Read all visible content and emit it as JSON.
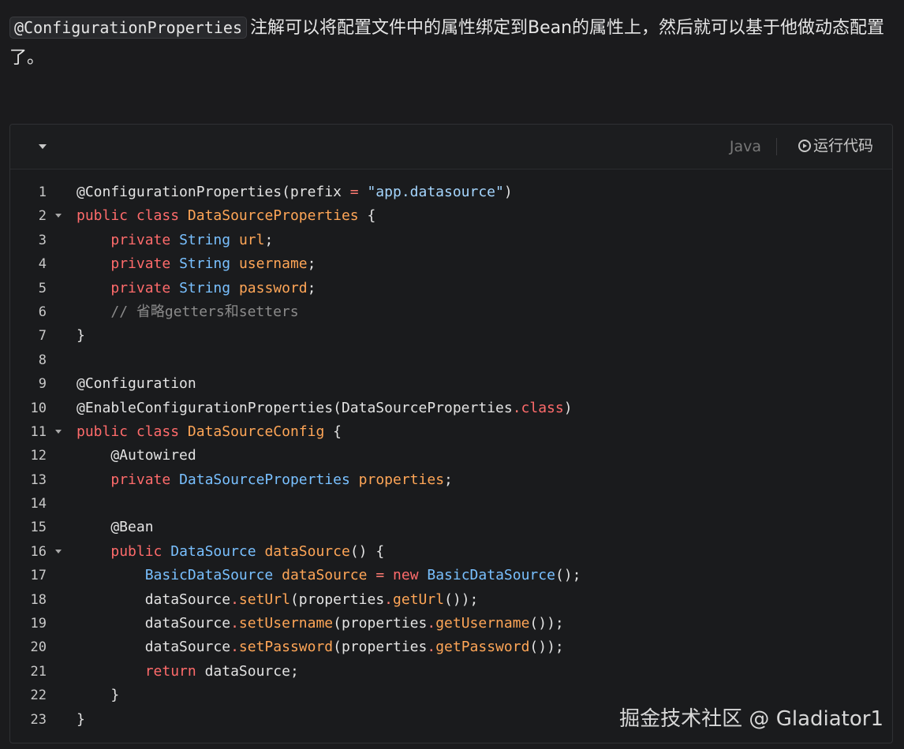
{
  "intro": {
    "code": "@ConfigurationProperties",
    "text": "注解可以将配置文件中的属性绑定到Bean的属性上，然后就可以基于他做动态配置了。"
  },
  "toolbar": {
    "language": "Java",
    "run_label": "运行代码",
    "collapse_icon": "chevron-down-icon",
    "run_icon": "play-circle-icon"
  },
  "code": {
    "lines": [
      {
        "n": "1",
        "fold": false,
        "tokens": [
          [
            "",
            "@ConfigurationProperties(prefix "
          ],
          [
            "op",
            "="
          ],
          [
            "",
            " "
          ],
          [
            "st",
            "\"app.datasource\""
          ],
          [
            "",
            ")"
          ]
        ]
      },
      {
        "n": "2",
        "fold": true,
        "tokens": [
          [
            "kw",
            "public"
          ],
          [
            "",
            " "
          ],
          [
            "kw",
            "class"
          ],
          [
            "",
            " "
          ],
          [
            "fn",
            "DataSourceProperties"
          ],
          [
            "",
            " {"
          ]
        ]
      },
      {
        "n": "3",
        "fold": false,
        "tokens": [
          [
            "",
            "    "
          ],
          [
            "kw",
            "private"
          ],
          [
            "",
            " "
          ],
          [
            "ty",
            "String"
          ],
          [
            "",
            " "
          ],
          [
            "fn",
            "url"
          ],
          [
            "",
            ";"
          ]
        ]
      },
      {
        "n": "4",
        "fold": false,
        "tokens": [
          [
            "",
            "    "
          ],
          [
            "kw",
            "private"
          ],
          [
            "",
            " "
          ],
          [
            "ty",
            "String"
          ],
          [
            "",
            " "
          ],
          [
            "fn",
            "username"
          ],
          [
            "",
            ";"
          ]
        ]
      },
      {
        "n": "5",
        "fold": false,
        "tokens": [
          [
            "",
            "    "
          ],
          [
            "kw",
            "private"
          ],
          [
            "",
            " "
          ],
          [
            "ty",
            "String"
          ],
          [
            "",
            " "
          ],
          [
            "fn",
            "password"
          ],
          [
            "",
            ";"
          ]
        ]
      },
      {
        "n": "6",
        "fold": false,
        "tokens": [
          [
            "",
            "    "
          ],
          [
            "cm",
            "// 省略getters和setters"
          ]
        ]
      },
      {
        "n": "7",
        "fold": false,
        "tokens": [
          [
            "",
            "}"
          ]
        ]
      },
      {
        "n": "8",
        "fold": false,
        "tokens": []
      },
      {
        "n": "9",
        "fold": false,
        "tokens": [
          [
            "",
            "@Configuration"
          ]
        ]
      },
      {
        "n": "10",
        "fold": false,
        "tokens": [
          [
            "",
            "@EnableConfigurationProperties(DataSourceProperties"
          ],
          [
            "op",
            "."
          ],
          [
            "kw",
            "class"
          ],
          [
            "",
            ")"
          ]
        ]
      },
      {
        "n": "11",
        "fold": true,
        "tokens": [
          [
            "kw",
            "public"
          ],
          [
            "",
            " "
          ],
          [
            "kw",
            "class"
          ],
          [
            "",
            " "
          ],
          [
            "fn",
            "DataSourceConfig"
          ],
          [
            "",
            " {"
          ]
        ]
      },
      {
        "n": "12",
        "fold": false,
        "tokens": [
          [
            "",
            "    @Autowired"
          ]
        ]
      },
      {
        "n": "13",
        "fold": false,
        "tokens": [
          [
            "",
            "    "
          ],
          [
            "kw",
            "private"
          ],
          [
            "",
            " "
          ],
          [
            "ty",
            "DataSourceProperties"
          ],
          [
            "",
            " "
          ],
          [
            "fn",
            "properties"
          ],
          [
            "",
            ";"
          ]
        ]
      },
      {
        "n": "14",
        "fold": false,
        "tokens": []
      },
      {
        "n": "15",
        "fold": false,
        "tokens": [
          [
            "",
            "    @Bean"
          ]
        ]
      },
      {
        "n": "16",
        "fold": true,
        "tokens": [
          [
            "",
            "    "
          ],
          [
            "kw",
            "public"
          ],
          [
            "",
            " "
          ],
          [
            "ty",
            "DataSource"
          ],
          [
            "",
            " "
          ],
          [
            "fn",
            "dataSource"
          ],
          [
            "",
            "() {"
          ]
        ]
      },
      {
        "n": "17",
        "fold": false,
        "tokens": [
          [
            "",
            "        "
          ],
          [
            "ty",
            "BasicDataSource"
          ],
          [
            "",
            " "
          ],
          [
            "fn",
            "dataSource"
          ],
          [
            "",
            " "
          ],
          [
            "op",
            "="
          ],
          [
            "",
            " "
          ],
          [
            "kw",
            "new"
          ],
          [
            "",
            " "
          ],
          [
            "ty",
            "BasicDataSource"
          ],
          [
            "",
            "();"
          ]
        ]
      },
      {
        "n": "18",
        "fold": false,
        "tokens": [
          [
            "",
            "        dataSource"
          ],
          [
            "op",
            "."
          ],
          [
            "fn",
            "setUrl"
          ],
          [
            "",
            "(properties"
          ],
          [
            "op",
            "."
          ],
          [
            "fn",
            "getUrl"
          ],
          [
            "",
            "());"
          ]
        ]
      },
      {
        "n": "19",
        "fold": false,
        "tokens": [
          [
            "",
            "        dataSource"
          ],
          [
            "op",
            "."
          ],
          [
            "fn",
            "setUsername"
          ],
          [
            "",
            "(properties"
          ],
          [
            "op",
            "."
          ],
          [
            "fn",
            "getUsername"
          ],
          [
            "",
            "());"
          ]
        ]
      },
      {
        "n": "20",
        "fold": false,
        "tokens": [
          [
            "",
            "        dataSource"
          ],
          [
            "op",
            "."
          ],
          [
            "fn",
            "setPassword"
          ],
          [
            "",
            "(properties"
          ],
          [
            "op",
            "."
          ],
          [
            "fn",
            "getPassword"
          ],
          [
            "",
            "());"
          ]
        ]
      },
      {
        "n": "21",
        "fold": false,
        "tokens": [
          [
            "",
            "        "
          ],
          [
            "kw",
            "return"
          ],
          [
            "",
            " dataSource;"
          ]
        ]
      },
      {
        "n": "22",
        "fold": false,
        "tokens": [
          [
            "",
            "    }"
          ]
        ]
      },
      {
        "n": "23",
        "fold": false,
        "tokens": [
          [
            "",
            "}"
          ]
        ]
      }
    ]
  },
  "watermark": "掘金技术社区 @ Gladiator1",
  "colors": {
    "background": "#1b1b1d",
    "keyword": "#ff6b6b",
    "type": "#79c0ff",
    "identifier": "#ffa657",
    "string": "#a5d6ff",
    "comment": "#8b8b8b"
  }
}
